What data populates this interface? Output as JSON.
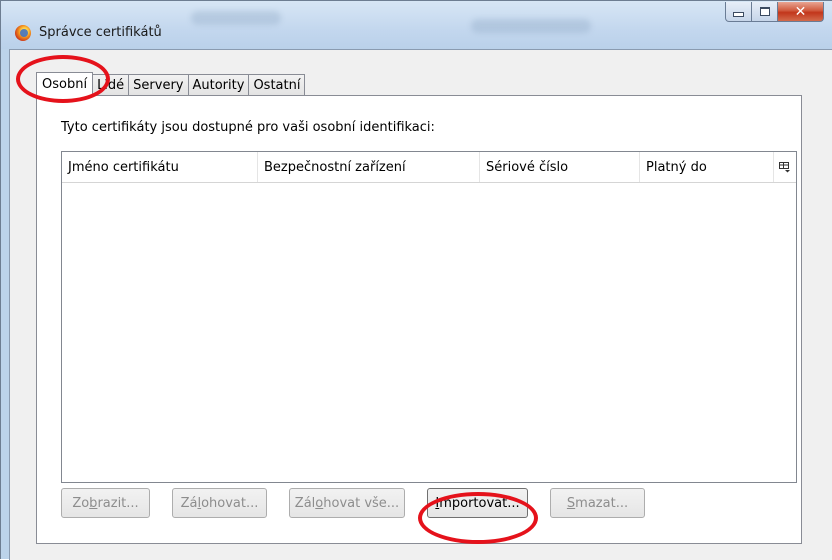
{
  "window": {
    "title": "Správce certifikátů",
    "app_icon": "firefox-icon",
    "controls": {
      "minimize": "minimize-icon",
      "maximize": "maximize-icon",
      "close": "close-icon"
    }
  },
  "tabs": [
    {
      "label": "Osobní",
      "active": true
    },
    {
      "label": "Lidé",
      "active": false
    },
    {
      "label": "Servery",
      "active": false
    },
    {
      "label": "Autority",
      "active": false
    },
    {
      "label": "Ostatní",
      "active": false
    }
  ],
  "panel": {
    "description": "Tyto certifikáty jsou dostupné pro vaši osobní identifikaci:",
    "columns": [
      "Jméno certifikátu",
      "Bezpečnostní zařízení",
      "Sériové číslo",
      "Platný do"
    ],
    "column_picker_icon": "column-picker-icon",
    "rows": []
  },
  "buttons": [
    {
      "pre": "Zo",
      "key": "b",
      "post": "razit...",
      "enabled": false
    },
    {
      "pre": "Zá",
      "key": "l",
      "post": "ohovat...",
      "enabled": false
    },
    {
      "pre": "Zál",
      "key": "o",
      "post": "hovat vše...",
      "enabled": false
    },
    {
      "pre": "",
      "key": "I",
      "post": "mportovat...",
      "enabled": true
    },
    {
      "pre": "",
      "key": "S",
      "post": "mazat...",
      "enabled": false
    }
  ],
  "annotation_color": "#e5121b"
}
